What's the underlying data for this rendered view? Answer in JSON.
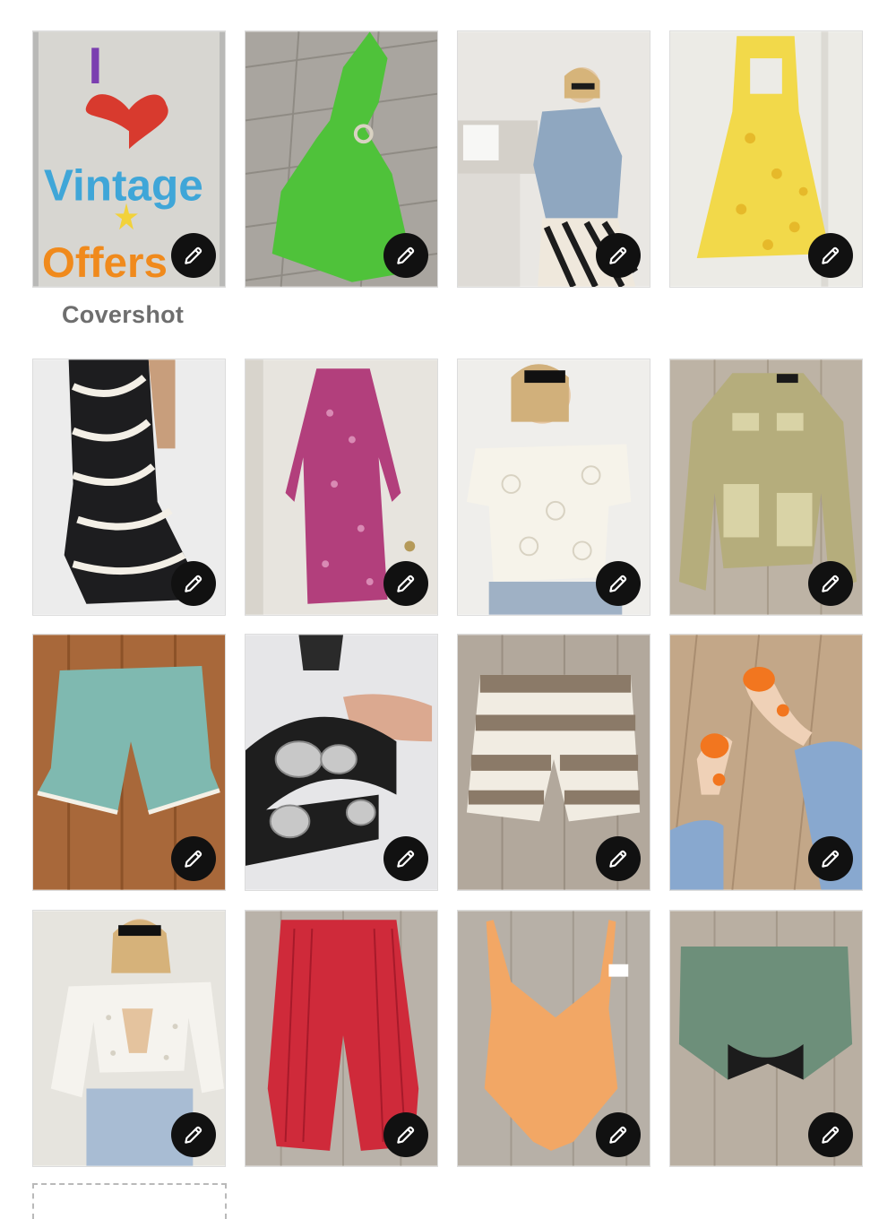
{
  "cover_label": "Covershot",
  "cover_sign": {
    "line1": "I",
    "line2": "Vintage",
    "line3": "Offers"
  },
  "edit_icon": "pencil-icon",
  "colors": {
    "edit_button_bg": "#111111",
    "cover_label": "#6e6e6e"
  },
  "photos": [
    {
      "name": "cover-photo-i-love-vintage-offers-sign"
    },
    {
      "name": "photo-green-crochet-halter-dress"
    },
    {
      "name": "photo-oversized-denim-jacket-zebra-pants"
    },
    {
      "name": "photo-yellow-floral-dress"
    },
    {
      "name": "photo-zebra-print-ruffle-skirt"
    },
    {
      "name": "photo-pink-print-long-sleeve-dress"
    },
    {
      "name": "photo-white-lace-off-shoulder-top"
    },
    {
      "name": "photo-gold-metallic-denim-jacket"
    },
    {
      "name": "photo-teal-crochet-shorts"
    },
    {
      "name": "photo-black-concho-leather-belt"
    },
    {
      "name": "photo-striped-knit-shorts"
    },
    {
      "name": "photo-orange-jelly-sandals"
    },
    {
      "name": "photo-white-eyelet-tie-front-blouse"
    },
    {
      "name": "photo-red-textured-wide-pants"
    },
    {
      "name": "photo-orange-one-piece-swimsuit"
    },
    {
      "name": "photo-green-knit-high-waist-bottoms"
    }
  ]
}
